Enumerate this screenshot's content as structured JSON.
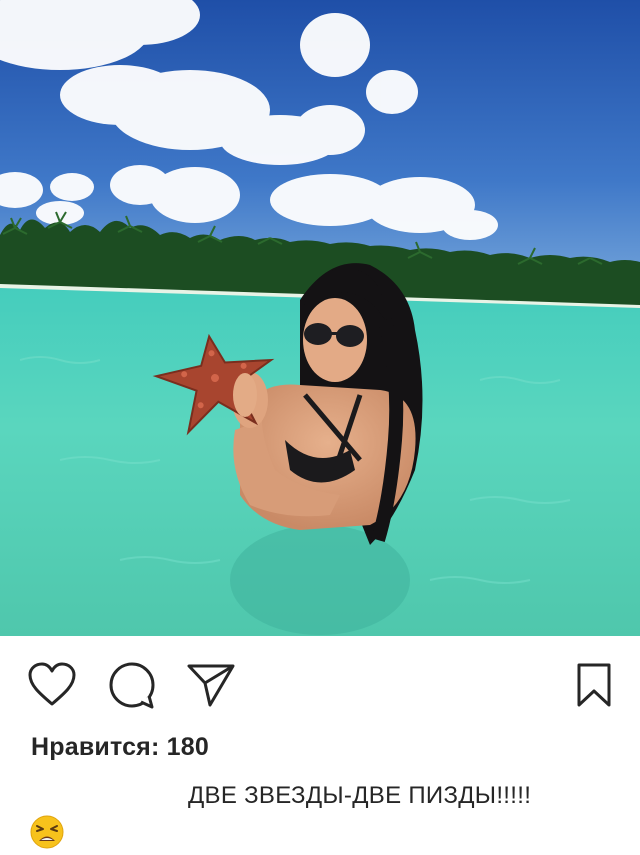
{
  "post": {
    "photo_icon": "photo-beach-starfish",
    "likes_text": "Нравится: 180",
    "caption": "ДВЕ ЗВЕЗДЫ-ДВЕ ПИЗДЫ!!!!!",
    "reaction_emoji": "weary-face-emoji"
  },
  "actions": {
    "like_icon": "heart-icon",
    "comment_icon": "comment-icon",
    "share_icon": "share-icon",
    "save_icon": "bookmark-icon"
  },
  "colors": {
    "sky": "#2e63b8",
    "water": "#52d1bd",
    "icon": "#262626",
    "text": "#262626"
  }
}
